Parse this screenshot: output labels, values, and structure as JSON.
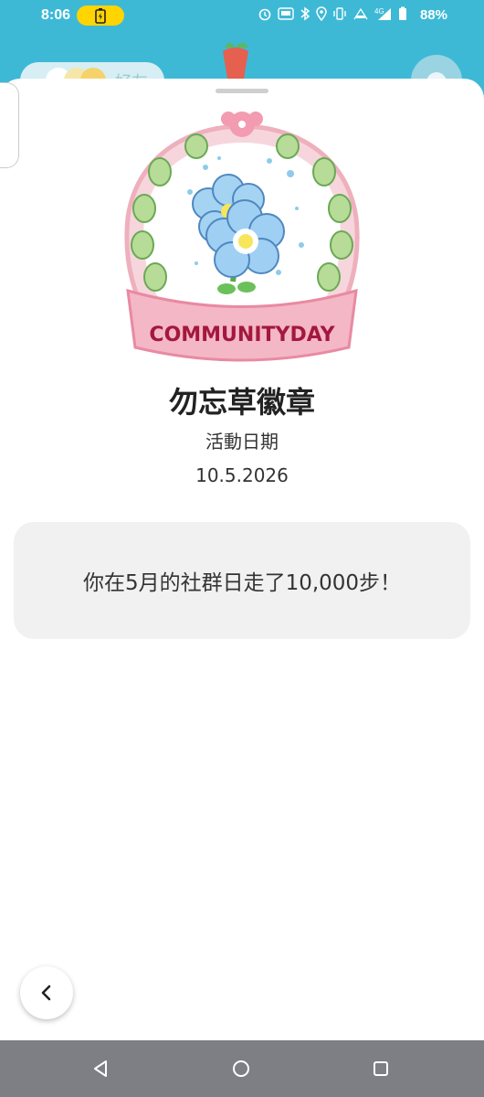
{
  "status_bar": {
    "time": "8:06",
    "battery_percent": "88%"
  },
  "background": {
    "friends_label": "好友"
  },
  "badge": {
    "banner_text": "COMMUNITYDAY",
    "name": "勿忘草徽章",
    "date_label": "活動日期",
    "date_value": "10.5.2026"
  },
  "message": {
    "text": "你在5月的社群日走了10,000步！"
  },
  "colors": {
    "header_blue": "#3db9d6",
    "card_gray": "#f1f1f1",
    "nav_gray": "#7d7f84",
    "badge_pink": "#f1a3b3",
    "flower_blue": "#9fd0f3"
  },
  "icons": [
    "battery-charging-icon",
    "alarm-icon",
    "bluetooth-icon",
    "location-icon",
    "vibrate-icon",
    "signal-icon",
    "battery-icon",
    "gear-icon",
    "chevron-left-icon",
    "nav-back-icon",
    "nav-home-icon",
    "nav-recents-icon"
  ]
}
